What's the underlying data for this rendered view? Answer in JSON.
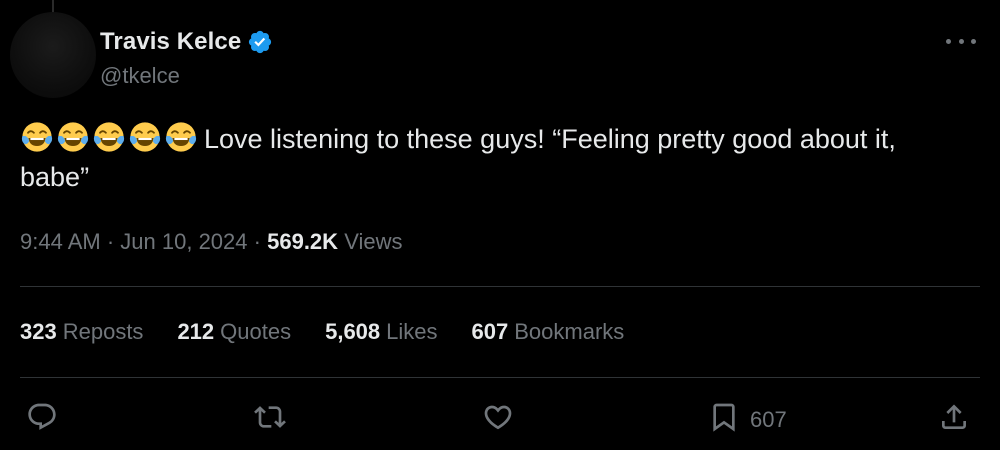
{
  "author": {
    "display_name": "Travis Kelce",
    "handle": "@tkelce",
    "verified": true,
    "verified_color": "#1d9bf0"
  },
  "tweet": {
    "emoji": [
      "face-with-tears-of-joy",
      "face-with-tears-of-joy",
      "face-with-tears-of-joy",
      "face-with-tears-of-joy",
      "face-with-tears-of-joy"
    ],
    "text": "Love listening to these guys! “Feeling pretty good about it, babe”",
    "time": "9:44 AM",
    "date": "Jun 10, 2024",
    "separator": "·",
    "views_count": "569.2K",
    "views_label": "Views"
  },
  "stats": [
    {
      "count": "323",
      "label": "Reposts"
    },
    {
      "count": "212",
      "label": "Quotes"
    },
    {
      "count": "5,608",
      "label": "Likes"
    },
    {
      "count": "607",
      "label": "Bookmarks"
    }
  ],
  "actions": {
    "reply_icon": "reply-icon",
    "repost_icon": "repost-icon",
    "like_icon": "heart-icon",
    "bookmark_icon": "bookmark-icon",
    "bookmark_count": "607",
    "share_icon": "share-icon"
  },
  "colors": {
    "background": "#000000",
    "primary_text": "#e7e9ea",
    "secondary_text": "#71767b",
    "divider": "#2f3336"
  }
}
